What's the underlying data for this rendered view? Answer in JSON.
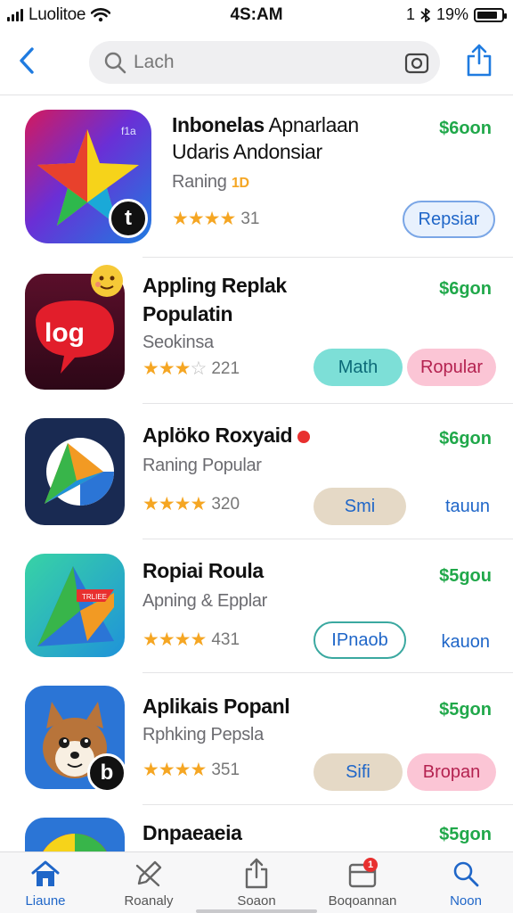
{
  "status_bar": {
    "carrier": "Luolitoe",
    "time": "4S:AM",
    "location_glyph": "1",
    "battery": "19%",
    "battery_level": 0.85
  },
  "nav": {
    "search_placeholder": "Lach"
  },
  "apps": [
    {
      "title_bold": "Inbonelas",
      "title_light": " Apnarlaan",
      "title_line2": "Udaris Andonsiar",
      "subtitle": "Raning",
      "subtitle_badge": "1D",
      "rating_count": "31",
      "stars": 4,
      "price": "$6oon",
      "action_label": "Repsiar",
      "icon_badge": "t"
    },
    {
      "title": "Appling Replak",
      "title_line2": "Populatin",
      "subtitle": "Seokinsa",
      "rating_count": "221",
      "stars": 3.5,
      "price": "$6gon",
      "tag1": "Math",
      "tag2": "Ropular",
      "icon_text": "log"
    },
    {
      "title": "Aplöko Roxyaid",
      "subtitle": "Raning Popular",
      "rating_count": "320",
      "stars": 4.5,
      "price": "$6gon",
      "tag1": "Smi",
      "link": "tauun"
    },
    {
      "title": "Ropiai Roula",
      "subtitle": "Apning & Epplar",
      "rating_count": "431",
      "stars": 4.5,
      "price": "$5gou",
      "tag1": "IPnaob",
      "link": "kauon",
      "icon_text": "TRLIEE"
    },
    {
      "title": "Aplikais Popanl",
      "subtitle": "Rphking Pepsla",
      "rating_count": "351",
      "stars": 4.5,
      "price": "$5gon",
      "tag1": "Sifi",
      "tag2": "Bropan",
      "icon_badge": "b"
    },
    {
      "title": "Dnpaeaeia",
      "price": "$5gon"
    }
  ],
  "tabs": [
    {
      "label": "Liaune",
      "icon": "home-icon"
    },
    {
      "label": "Roanaly",
      "icon": "pen-icon"
    },
    {
      "label": "Soaon",
      "icon": "share-icon"
    },
    {
      "label": "Boqoannan",
      "icon": "tray-icon",
      "badge": "1"
    },
    {
      "label": "Noon",
      "icon": "search-icon"
    }
  ],
  "colors": {
    "accent": "#1f66c8",
    "price_green": "#20a84a",
    "star": "#f5a623"
  }
}
